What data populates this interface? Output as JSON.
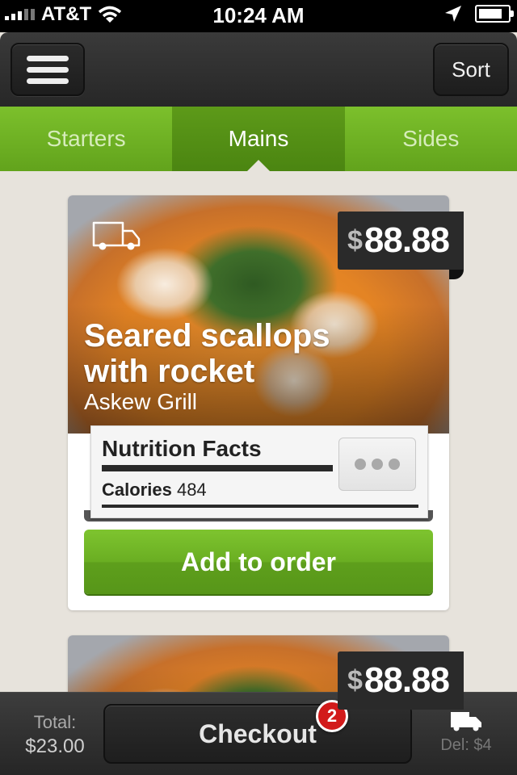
{
  "status_bar": {
    "carrier": "AT&T",
    "time": "10:24 AM",
    "icons": [
      "signal-icon",
      "wifi-icon",
      "location-arrow-icon",
      "battery-icon"
    ]
  },
  "nav": {
    "menu_icon": "hamburger-menu-icon",
    "sort_label": "Sort"
  },
  "tabs": [
    {
      "label": "Starters",
      "active": false
    },
    {
      "label": "Mains",
      "active": true
    },
    {
      "label": "Sides",
      "active": false
    }
  ],
  "cards": [
    {
      "currency": "$",
      "price": "88.88",
      "title": "Seared scallops with rocket",
      "restaurant": "Askew Grill",
      "badge_icon": "delivery-truck-icon",
      "nutrition": {
        "title": "Nutrition Facts",
        "calories_label": "Calories",
        "calories_value": "484",
        "more_icon": "more-dots-icon"
      },
      "action_label": "Add to order"
    },
    {
      "currency": "$",
      "price": "88.88"
    }
  ],
  "bottom_bar": {
    "total_label": "Total:",
    "total_value": "$23.00",
    "checkout_label": "Checkout",
    "cart_count": "2",
    "delivery_fee": "Del: $4",
    "delivery_icon": "delivery-truck-icon"
  },
  "colors": {
    "accent_green": "#6aae22",
    "badge_red": "#d21a1a",
    "background": "#e7e3dc"
  }
}
